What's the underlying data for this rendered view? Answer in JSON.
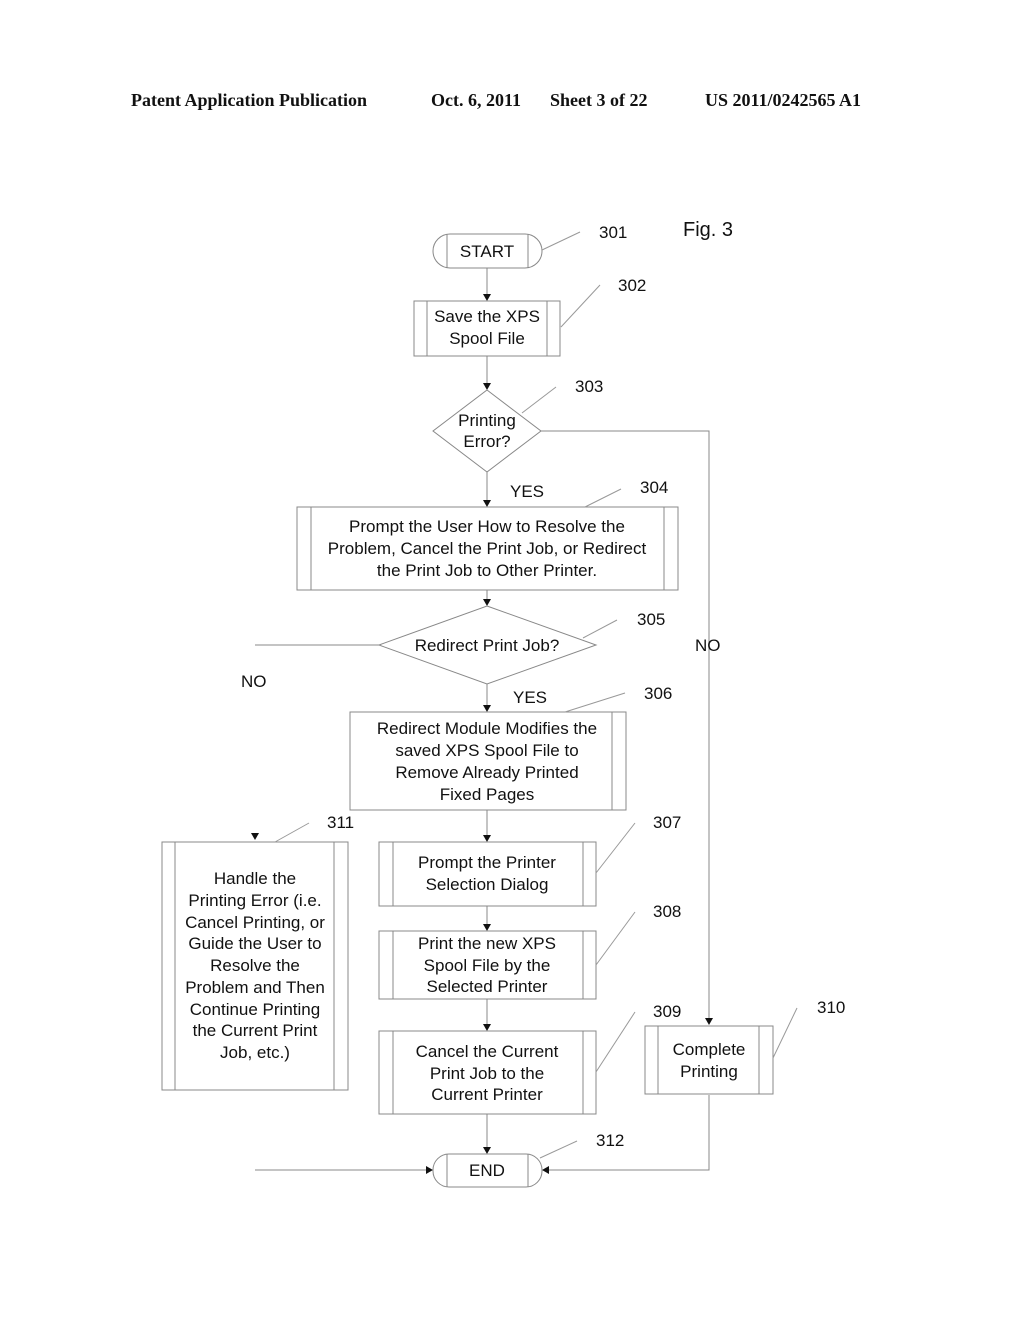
{
  "header": {
    "publication": "Patent Application Publication",
    "date": "Oct. 6, 2011",
    "sheet": "Sheet 3 of 22",
    "number": "US 2011/0242565 A1"
  },
  "figure_label": "Fig. 3",
  "nodes": {
    "n301": {
      "ref": "301",
      "lines": [
        "START"
      ]
    },
    "n302": {
      "ref": "302",
      "lines": [
        "Save the XPS",
        "Spool File"
      ]
    },
    "n303": {
      "ref": "303",
      "lines": [
        "Printing",
        "Error?"
      ]
    },
    "n304": {
      "ref": "304",
      "lines": [
        "Prompt the User How to Resolve the",
        "Problem, Cancel the Print Job, or Redirect",
        "the Print Job to Other Printer."
      ]
    },
    "n305": {
      "ref": "305",
      "lines": [
        "Redirect Print Job?"
      ]
    },
    "n306": {
      "ref": "306",
      "lines": [
        "Redirect Module Modifies the",
        "saved XPS Spool File to",
        "Remove Already Printed",
        "Fixed Pages"
      ]
    },
    "n307": {
      "ref": "307",
      "lines": [
        "Prompt the Printer",
        "Selection Dialog"
      ]
    },
    "n308": {
      "ref": "308",
      "lines": [
        "Print the new XPS",
        "Spool File by the",
        "Selected Printer"
      ]
    },
    "n309": {
      "ref": "309",
      "lines": [
        "Cancel the Current",
        "Print Job to the",
        "Current Printer"
      ]
    },
    "n310": {
      "ref": "310",
      "lines": [
        "Complete",
        "Printing"
      ]
    },
    "n311": {
      "ref": "311",
      "lines": [
        "Handle the",
        "Printing Error (i.e.",
        "Cancel Printing, or",
        "Guide the User to",
        "Resolve the",
        "Problem and Then",
        "Continue Printing",
        "the Current Print",
        "Job, etc.)"
      ]
    },
    "n312": {
      "ref": "312",
      "lines": [
        "END"
      ]
    }
  },
  "edge_labels": {
    "e303_yes": "YES",
    "e303_no": "NO",
    "e305_yes": "YES",
    "e305_no": "NO"
  }
}
